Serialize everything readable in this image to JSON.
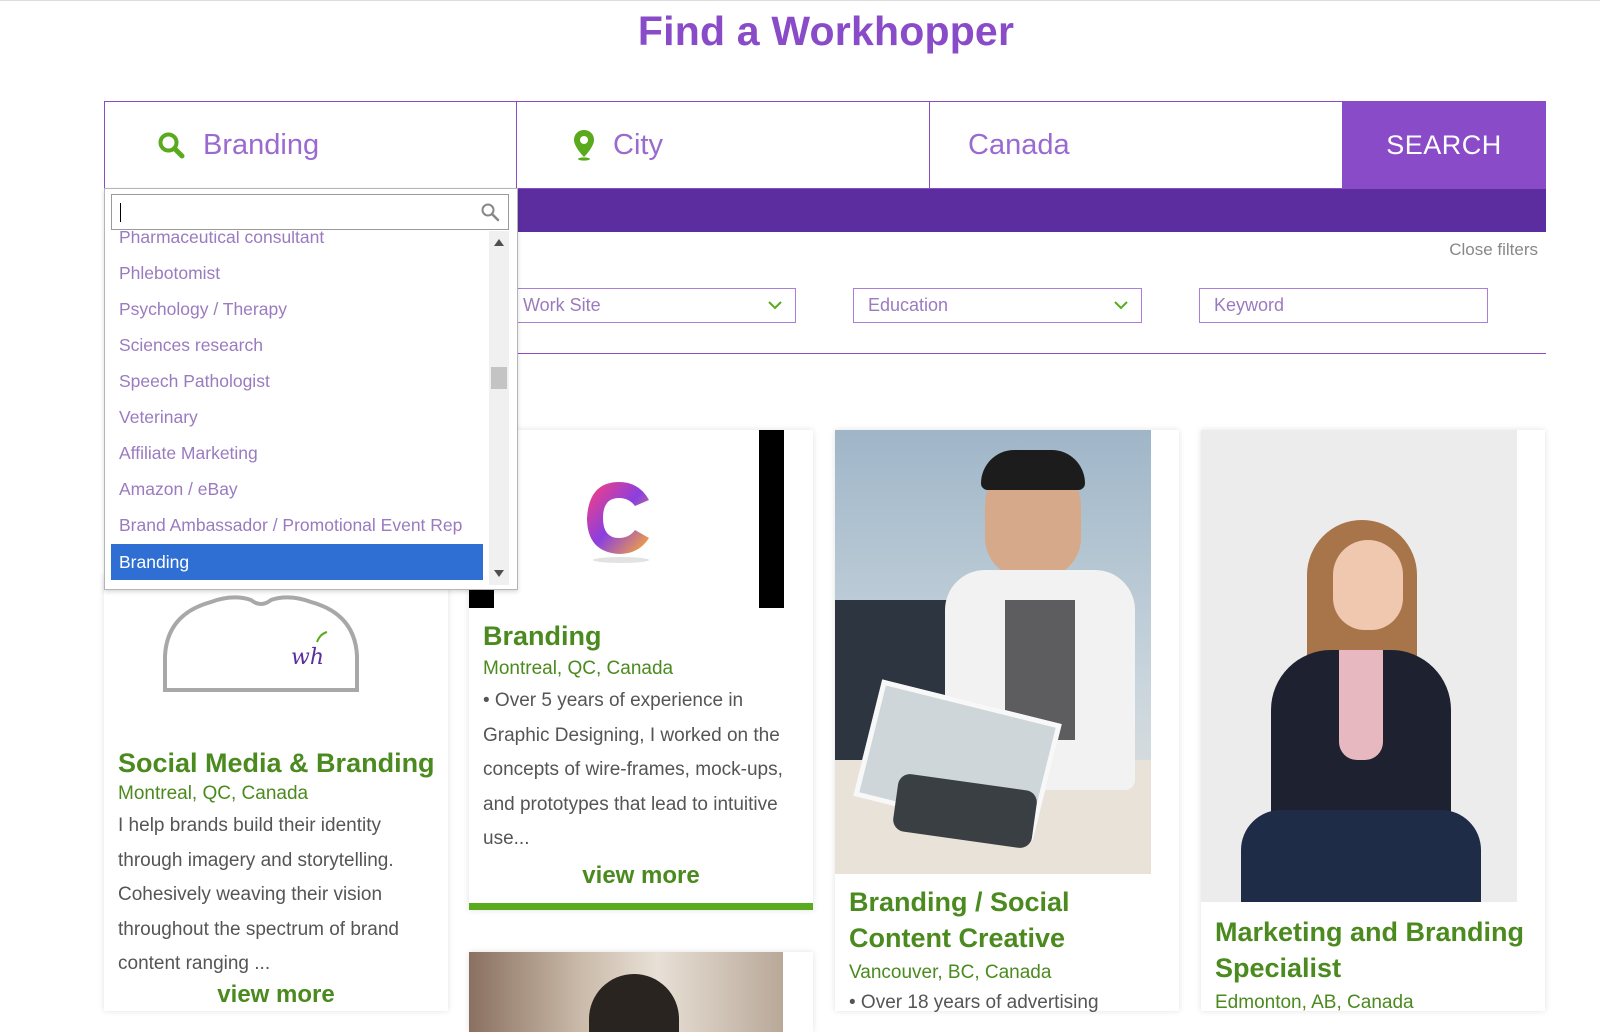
{
  "page": {
    "title": "Find a Workhopper"
  },
  "search": {
    "keyword_value": "Branding",
    "city_placeholder": "City",
    "country_value": "Canada",
    "button_label": "SEARCH",
    "icons": {
      "keyword": "search-icon",
      "city": "map-pin-icon"
    }
  },
  "filters": {
    "close_label": "Close filters",
    "work_site": "Work Site",
    "education": "Education",
    "keyword_placeholder": "Keyword"
  },
  "dropdown": {
    "search_value": "",
    "items": [
      "Pharmaceutical consultant",
      "Phlebotomist",
      "Psychology / Therapy",
      "Sciences research",
      "Speech Pathologist",
      "Veterinary",
      "Affiliate Marketing",
      "Amazon / eBay",
      "Brand Ambassador / Promotional Event Rep",
      "Branding"
    ],
    "selected": "Branding"
  },
  "cards": [
    {
      "title": "Social Media & Branding",
      "location": "Montreal, QC, Canada",
      "description": "I help brands build their identity through imagery and storytelling. Cohesively weaving their vision throughout the spectrum of brand content ranging ...",
      "view_more": "view more"
    },
    {
      "title": "Branding",
      "location": "Montreal, QC, Canada",
      "description": "• Over 5 years of experience in Graphic Designing, I worked on the concepts of wire-frames, mock-ups, and prototypes that lead to intuitive use...",
      "view_more": "view more"
    },
    {
      "title": "Branding / Social Content Creative",
      "location": "Vancouver, BC, Canada",
      "description": "• Over 18 years of advertising"
    },
    {
      "title": "Marketing and Branding Specialist",
      "location": "Edmonton, AB, Canada"
    }
  ],
  "colors": {
    "brand_purple": "#8a4bc9",
    "dark_purple": "#5c2d9e",
    "green": "#4b8a1e",
    "selection_blue": "#2f6fd4"
  }
}
